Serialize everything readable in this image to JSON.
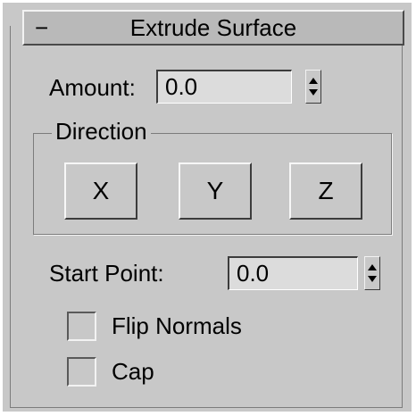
{
  "rollout": {
    "collapse_symbol": "−",
    "title": "Extrude Surface"
  },
  "amount": {
    "label": "Amount:",
    "value": "0.0"
  },
  "direction": {
    "group_label": "Direction",
    "buttons": [
      {
        "label": "X"
      },
      {
        "label": "Y"
      },
      {
        "label": "Z"
      }
    ]
  },
  "start_point": {
    "label": "Start Point:",
    "value": "0.0"
  },
  "options": {
    "flip_normals": {
      "label": "Flip Normals",
      "checked": false
    },
    "cap": {
      "label": "Cap",
      "checked": false
    }
  }
}
